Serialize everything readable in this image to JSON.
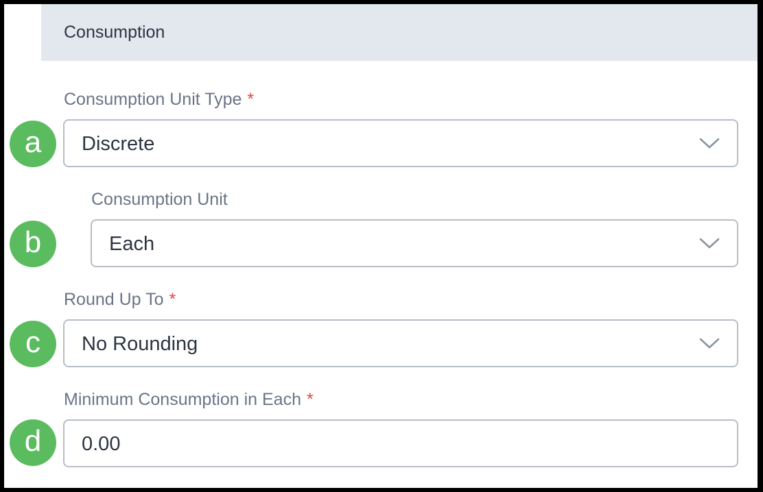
{
  "section": {
    "title": "Consumption"
  },
  "fields": {
    "unit_type": {
      "label": "Consumption Unit Type",
      "required_mark": "*",
      "value": "Discrete",
      "badge": "a"
    },
    "unit": {
      "label": "Consumption Unit",
      "value": "Each",
      "badge": "b"
    },
    "round_up": {
      "label": "Round Up To",
      "required_mark": "*",
      "value": "No Rounding",
      "badge": "c"
    },
    "min_consumption": {
      "label": "Minimum Consumption in Each",
      "required_mark": "*",
      "value": "0.00",
      "badge": "d"
    }
  },
  "icons": {
    "dropdown": "chevron-down-icon"
  },
  "colors": {
    "header_bg": "#e3e8ef",
    "label": "#6a7486",
    "required": "#e2463f",
    "badge": "#5bbb5f",
    "border": "#b7bdc6",
    "text": "#2c3441"
  }
}
